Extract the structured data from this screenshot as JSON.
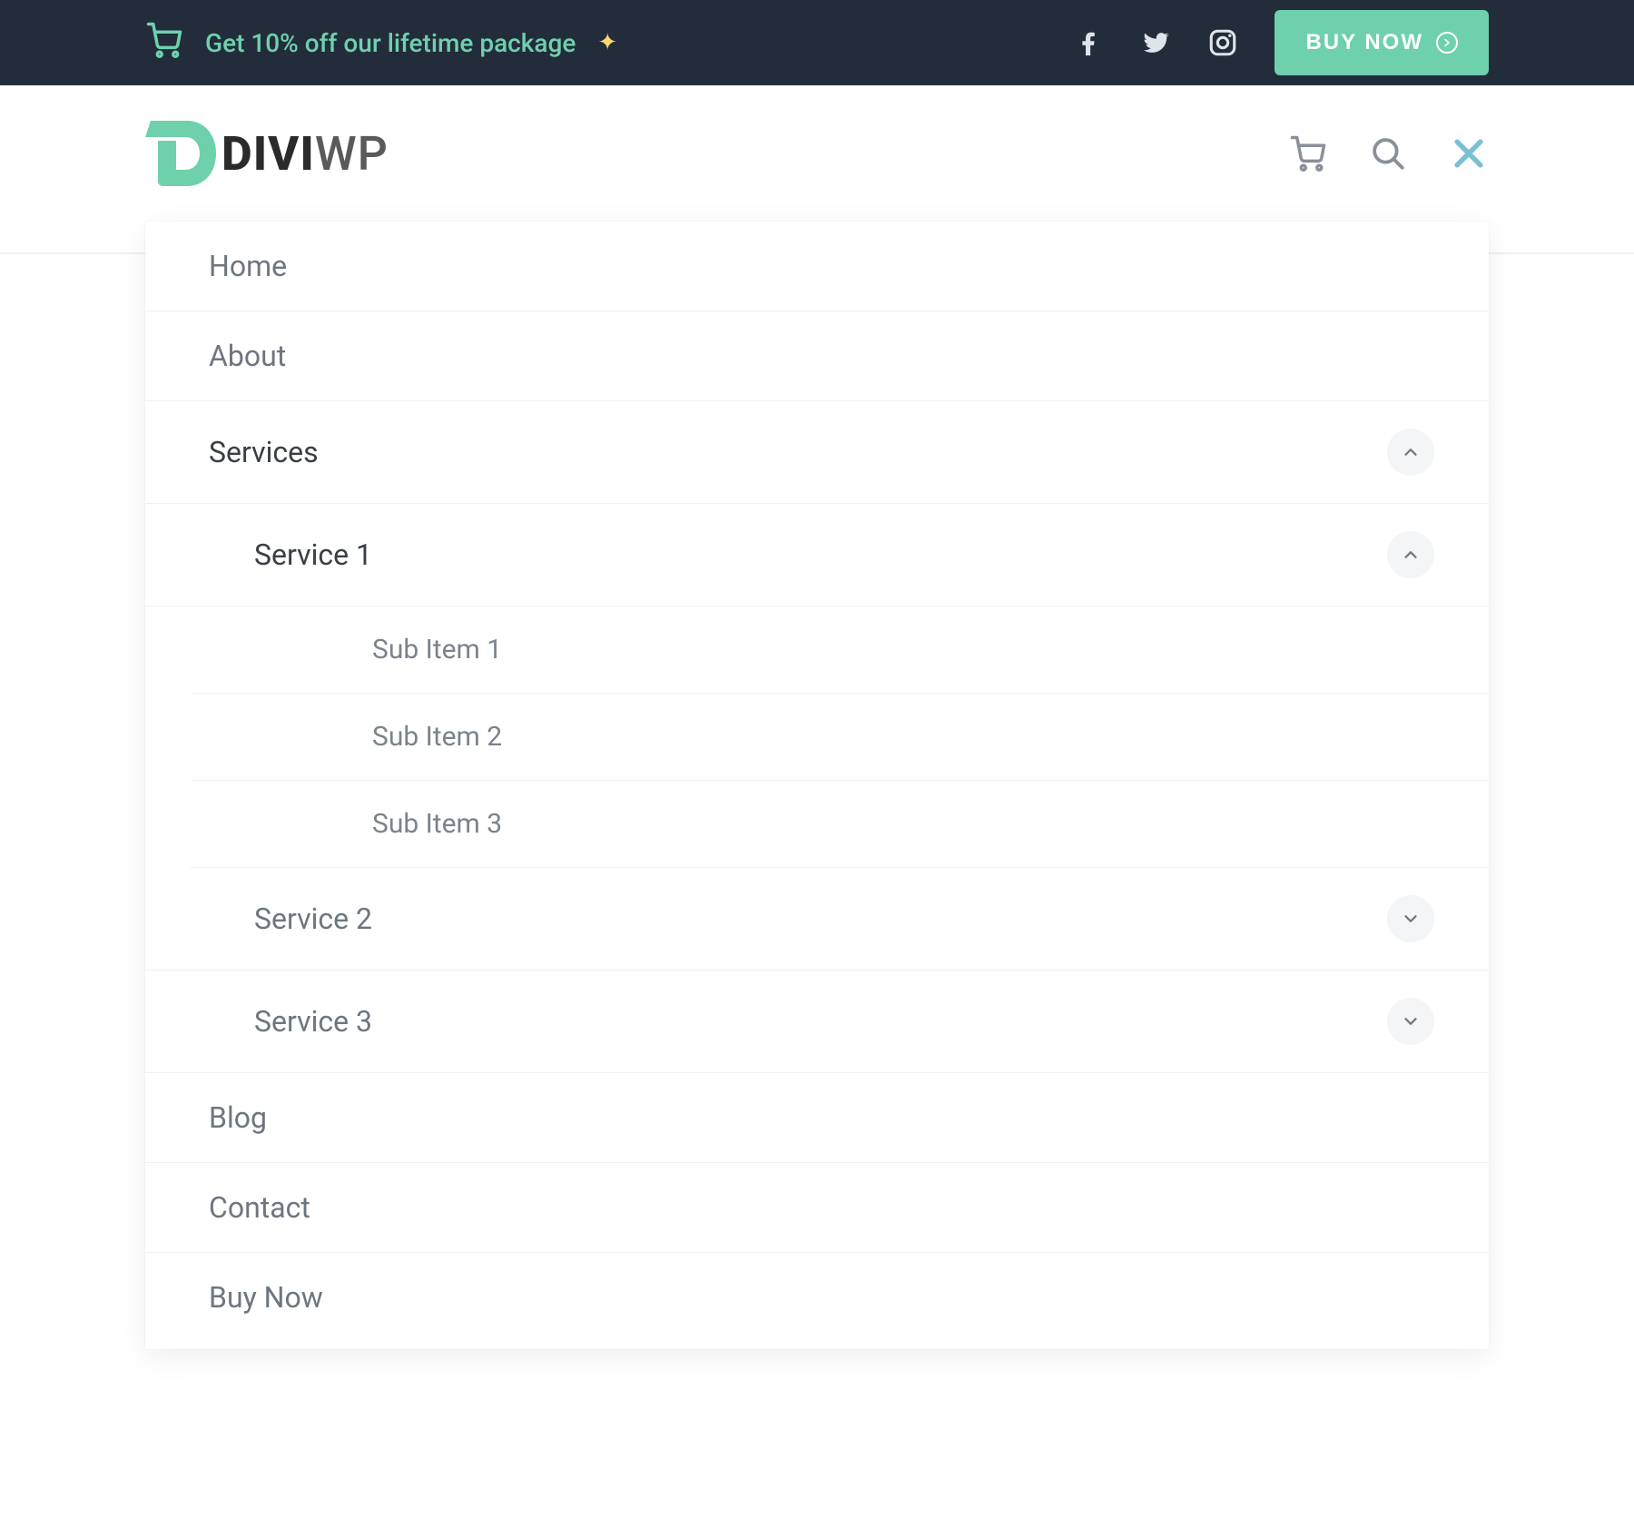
{
  "colors": {
    "accent": "#6ed1ac",
    "topbar_bg": "#232c3b",
    "text_muted": "#6d7680",
    "close_x": "#7bbfd6"
  },
  "topbar": {
    "promo_text": "Get 10% off our lifetime package",
    "sparkle_icon": "sparkle-icon",
    "cart_icon": "cart-icon",
    "social": [
      "facebook",
      "twitter",
      "instagram"
    ],
    "buy_button_label": "BUY NOW"
  },
  "header": {
    "logo_text_main": "DIVI",
    "logo_text_sub": "WP",
    "actions": {
      "cart_icon": "cart-icon",
      "search_icon": "search-icon",
      "close_icon": "close-icon"
    }
  },
  "menu": {
    "items": [
      {
        "label": "Home"
      },
      {
        "label": "About"
      },
      {
        "label": "Services",
        "expanded": true,
        "children": [
          {
            "label": "Service 1",
            "expanded": true,
            "children": [
              {
                "label": "Sub Item 1"
              },
              {
                "label": "Sub Item 2"
              },
              {
                "label": "Sub Item 3"
              }
            ]
          },
          {
            "label": "Service 2",
            "expanded": false
          },
          {
            "label": "Service 3",
            "expanded": false
          }
        ]
      },
      {
        "label": "Blog"
      },
      {
        "label": "Contact"
      },
      {
        "label": "Buy Now"
      }
    ]
  }
}
